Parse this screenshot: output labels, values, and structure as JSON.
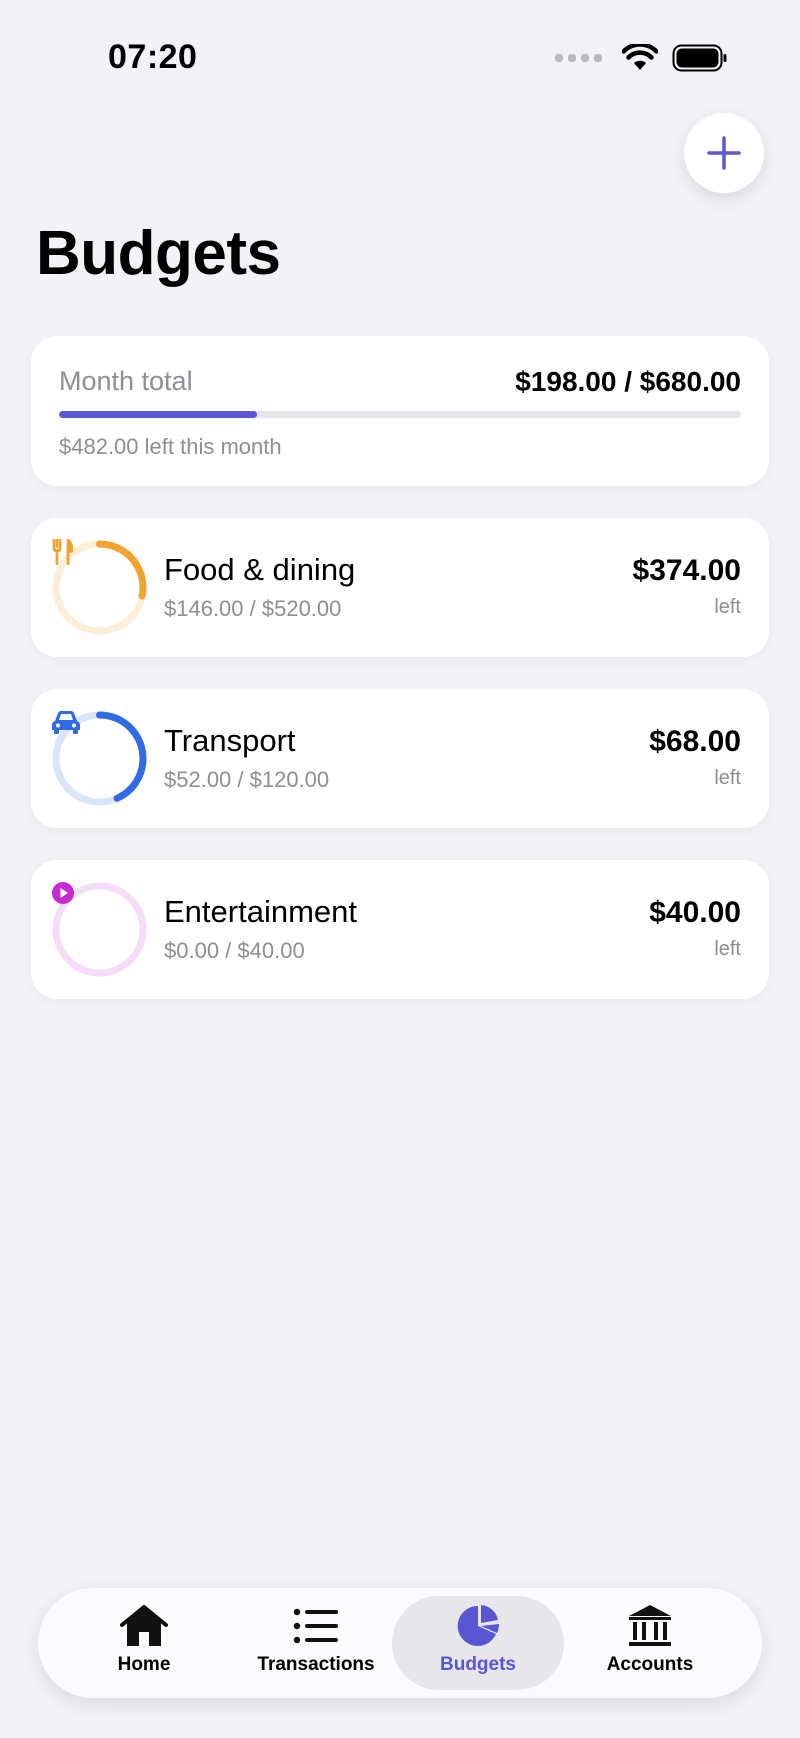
{
  "status_bar": {
    "time": "07:20"
  },
  "colors": {
    "accent": "#5b57d6",
    "food": "#f2a22e",
    "food_track": "#fdeed8",
    "transport": "#2f6be4",
    "transport_track": "#d9e5fb",
    "entertainment": "#c62bd1",
    "entertainment_track": "#f5ddf7"
  },
  "header": {
    "title": "Budgets",
    "add_icon": "plus-icon"
  },
  "summary": {
    "label": "Month total",
    "amount": "$198.00 / $680.00",
    "progress": 0.291,
    "left_text": "$482.00 left this month"
  },
  "budgets": [
    {
      "name": "Food & dining",
      "spent": "$146.00 / $520.00",
      "left": "$374.00",
      "left_label": "left",
      "progress": 0.281,
      "icon": "fork-knife-icon"
    },
    {
      "name": "Transport",
      "spent": "$52.00 / $120.00",
      "left": "$68.00",
      "left_label": "left",
      "progress": 0.433,
      "icon": "car-icon"
    },
    {
      "name": "Entertainment",
      "spent": "$0.00 / $40.00",
      "left": "$40.00",
      "left_label": "left",
      "progress": 0.0,
      "icon": "play-icon"
    }
  ],
  "tab_bar": {
    "tabs": [
      {
        "label": "Home",
        "icon": "home-icon"
      },
      {
        "label": "Transactions",
        "icon": "list-icon"
      },
      {
        "label": "Budgets",
        "icon": "pie-chart-icon",
        "active": true
      },
      {
        "label": "Accounts",
        "icon": "bank-icon"
      }
    ]
  }
}
